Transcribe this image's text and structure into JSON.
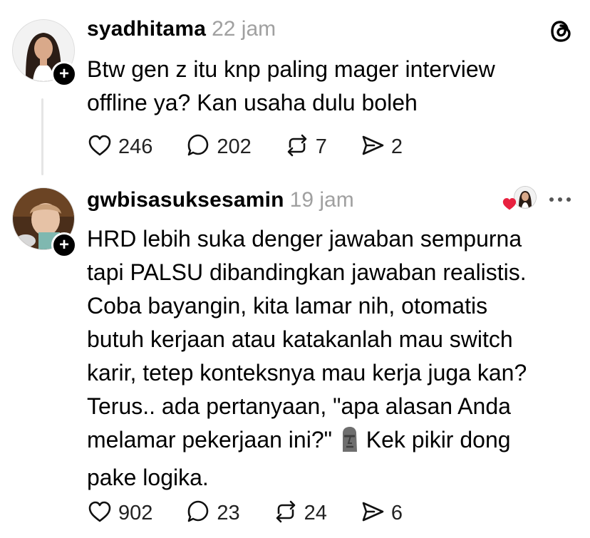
{
  "posts": [
    {
      "username": "syadhitama",
      "time": "22 jam",
      "text_lines": [
        "Btw gen z itu knp paling mager interview",
        "offline ya? Kan usaha dulu boleh"
      ],
      "likes": "246",
      "comments": "202",
      "reposts": "7",
      "shares": "2"
    },
    {
      "username": "gwbisasuksesamin",
      "time": "19 jam",
      "text_lines": [
        "HRD lebih suka denger jawaban sempurna",
        "tapi PALSU dibandingkan jawaban realistis.",
        "Coba bayangin, kita lamar nih, otomatis",
        "butuh kerjaan atau katakanlah mau switch",
        "karir, tetep konteksnya mau kerja juga kan?",
        "Terus.. ada pertanyaan, \"apa alasan Anda",
        "melamar pekerjaan ini?\"",
        "Kek pikir dong",
        "pake logika."
      ],
      "likes": "902",
      "comments": "23",
      "reposts": "24",
      "shares": "6"
    }
  ],
  "icons": {
    "threads_logo": "threads-logo-icon",
    "like": "heart-icon",
    "comment": "comment-icon",
    "repost": "repost-icon",
    "share": "share-icon",
    "more": "more-icon",
    "moai": "moai-emoji"
  },
  "colors": {
    "liked_heart": "#e8213f",
    "muted": "#a0a0a0",
    "line": "#e5e5e5"
  }
}
